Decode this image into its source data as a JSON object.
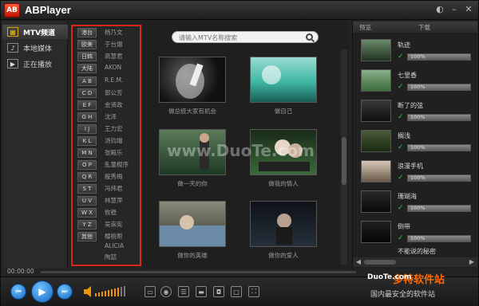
{
  "app": {
    "title": "ABPlayer",
    "logo_text": "AB"
  },
  "nav": {
    "items": [
      {
        "label": "MTV频道",
        "icon": "mtv-icon"
      },
      {
        "label": "本地媒体",
        "icon": "music-note-icon"
      },
      {
        "label": "正在播放",
        "icon": "play-icon"
      }
    ]
  },
  "index": {
    "buttons": [
      "港台",
      "欧美",
      "日韩",
      "大陆",
      "A B",
      "C D",
      "E F",
      "G H",
      "I J",
      "K L",
      "M N",
      "O P",
      "Q R",
      "S T",
      "U V",
      "W X",
      "Y Z",
      "其他"
    ],
    "artists": [
      "杨乃文",
      "于台烟",
      "高慧君",
      "AKON",
      "R.E.M.",
      "郭公芳",
      "金贤政",
      "沈泽",
      "王力宏",
      "汤钧瑞",
      "张殿乐",
      "乱童楔序",
      "殷秀梅",
      "冯炜君",
      "林慧萍",
      "攸稳",
      "吴崇宪",
      "樱桃帮",
      "ALICIA",
      "陶喆"
    ]
  },
  "search": {
    "placeholder": "请输入MTV名称搜索"
  },
  "videos": [
    {
      "caption": "做总统大家有机会"
    },
    {
      "caption": "做自己"
    },
    {
      "caption": "做一天的你"
    },
    {
      "caption": "做我的情人"
    },
    {
      "caption": "做你的英雄"
    },
    {
      "caption": "做你的爱人"
    }
  ],
  "downloads": {
    "header_preview": "预览",
    "header_download": "下载",
    "items": [
      {
        "title": "轨迹",
        "progress_label": "100%",
        "progress": 1.0
      },
      {
        "title": "七里香",
        "progress_label": "100%",
        "progress": 1.0
      },
      {
        "title": "断了的弦",
        "progress_label": "100%",
        "progress": 1.0
      },
      {
        "title": "搁浅",
        "progress_label": "100%",
        "progress": 1.0
      },
      {
        "title": "浪漫手机",
        "progress_label": "100%",
        "progress": 1.0
      },
      {
        "title": "珊瑚海",
        "progress_label": "100%",
        "progress": 1.0
      },
      {
        "title": "倒带",
        "progress_label": "100%",
        "progress": 1.0
      },
      {
        "title": "不能说的秘密",
        "progress_label": ""
      }
    ]
  },
  "player": {
    "time": "00:00:00",
    "time_right": "00:00:00"
  },
  "watermark": {
    "center": "www.DuoTe.com",
    "br_text": "多特软件站",
    "br_domain": "DuoTe.com",
    "br_slogan": "国内最安全的软件站"
  },
  "colors": {
    "accent_red": "#d8281e",
    "progress_green": "#2ecc40",
    "control_blue": "#1e88e5"
  }
}
